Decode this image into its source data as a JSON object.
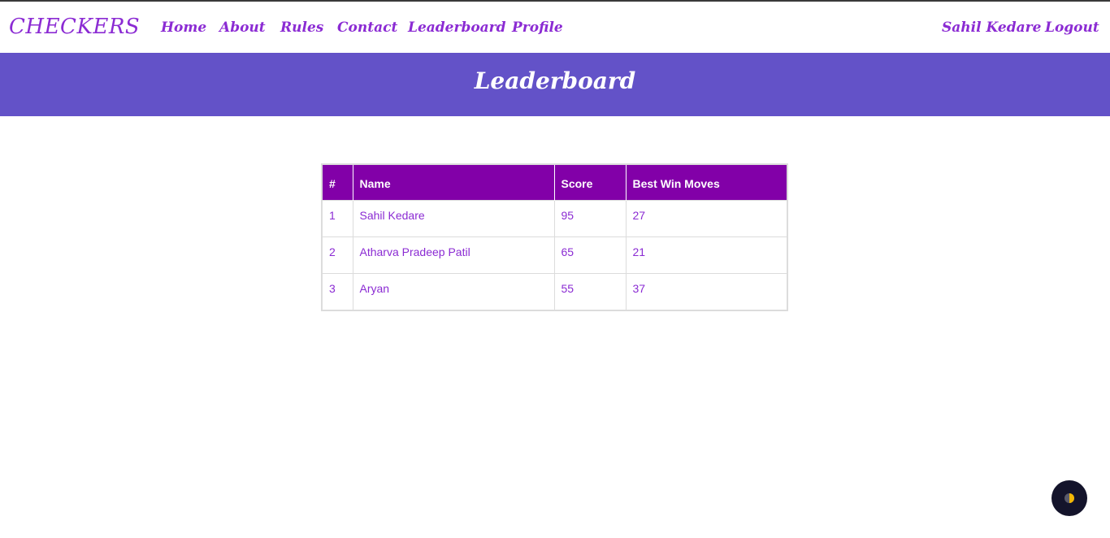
{
  "nav": {
    "brand": "CHECKERS",
    "links": [
      {
        "label": "Home"
      },
      {
        "label": "About"
      },
      {
        "label": "Rules"
      },
      {
        "label": "Contact"
      },
      {
        "label": "Leaderboard"
      },
      {
        "label": "Profile"
      }
    ],
    "user_name": "Sahil Kedare",
    "logout_label": "Logout"
  },
  "banner": {
    "title": "Leaderboard"
  },
  "leaderboard": {
    "columns": [
      "#",
      "Name",
      "Score",
      "Best Win Moves"
    ],
    "rows": [
      {
        "rank": "1",
        "name": "Sahil Kedare",
        "score": "95",
        "best_win_moves": "27"
      },
      {
        "rank": "2",
        "name": "Atharva Pradeep Patil",
        "score": "65",
        "best_win_moves": "21"
      },
      {
        "rank": "3",
        "name": "Aryan",
        "score": "55",
        "best_win_moves": "37"
      }
    ]
  },
  "theme_toggle": {
    "icon": "half-moon-icon"
  },
  "colors": {
    "accent": "#8b2bd3",
    "banner": "#6352c8",
    "table_header": "#8200a8",
    "toggle_bg": "#14142b",
    "toggle_icon": "#f2b705"
  }
}
